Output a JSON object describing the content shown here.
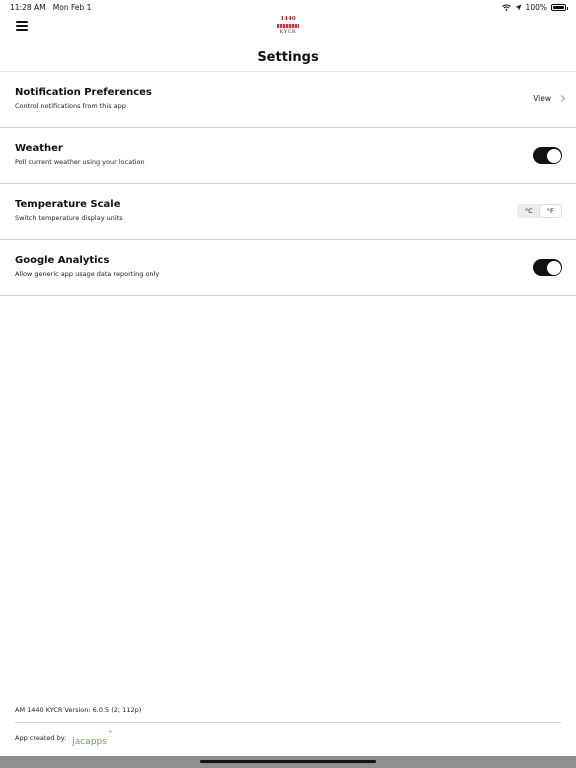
{
  "status_bar": {
    "time": "11:28 AM",
    "date": "Mon Feb 1",
    "battery": "100%",
    "icons": [
      "wifi-icon",
      "location-arrow-icon",
      "battery-icon"
    ]
  },
  "nav": {
    "logo_top": "1440",
    "logo_bottom": "KYCR",
    "menu_icon": "hamburger-menu-icon"
  },
  "page": {
    "title": "Settings"
  },
  "settings": {
    "notifications": {
      "title": "Notification Preferences",
      "subtitle": "Control notifications from this app",
      "action": "View"
    },
    "weather": {
      "title": "Weather",
      "subtitle": "Poll current weather using your location",
      "enabled": true
    },
    "temperature": {
      "title": "Temperature Scale",
      "subtitle": "Switch temperature display units",
      "options": [
        "°C",
        "°F"
      ],
      "selected": "°F"
    },
    "analytics": {
      "title": "Google Analytics",
      "subtitle": "Allow generic app usage data reporting only",
      "enabled": true
    }
  },
  "footer": {
    "version": "AM 1440 KYCR Version: 6.0.5 (2; 112p)",
    "created_by_label": "App created by:",
    "brand": "jacapps"
  },
  "colors": {
    "toggle_on": "#111111",
    "divider": "#cfcfcf",
    "brand_green": "#6aa84f",
    "logo_red": "#9b1b1b"
  }
}
